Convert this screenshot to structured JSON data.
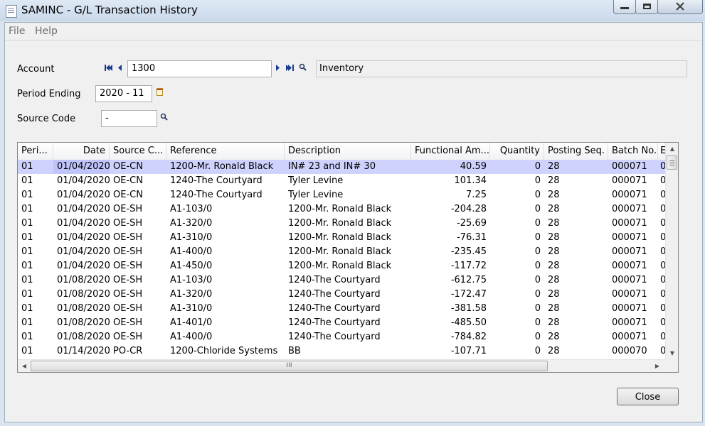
{
  "window": {
    "title": "SAMINC - G/L Transaction History"
  },
  "menu": {
    "file": "File",
    "help": "Help"
  },
  "form": {
    "account_label": "Account",
    "account_value": "1300",
    "account_description": "Inventory",
    "period_label": "Period Ending",
    "period_value": "2020 - 11",
    "source_label": "Source Code",
    "source_value": "-"
  },
  "grid": {
    "columns": [
      "Peri...",
      "Date",
      "Source C...",
      "Reference",
      "Description",
      "Functional Am...",
      "Quantity",
      "Posting Seq.",
      "Batch No.",
      "E"
    ],
    "rows": [
      [
        "01",
        "01/04/2020",
        "OE-CN",
        "1200-Mr. Ronald Black",
        "IN# 23 and IN# 30",
        "40.59",
        "0",
        "28",
        "000071",
        "0"
      ],
      [
        "01",
        "01/04/2020",
        "OE-CN",
        "1240-The Courtyard",
        "Tyler Levine",
        "101.34",
        "0",
        "28",
        "000071",
        "0"
      ],
      [
        "01",
        "01/04/2020",
        "OE-CN",
        "1240-The Courtyard",
        "Tyler Levine",
        "7.25",
        "0",
        "28",
        "000071",
        "0"
      ],
      [
        "01",
        "01/04/2020",
        "OE-SH",
        "A1-103/0",
        "1200-Mr. Ronald Black",
        "-204.28",
        "0",
        "28",
        "000071",
        "0"
      ],
      [
        "01",
        "01/04/2020",
        "OE-SH",
        "A1-320/0",
        "1200-Mr. Ronald Black",
        "-25.69",
        "0",
        "28",
        "000071",
        "0"
      ],
      [
        "01",
        "01/04/2020",
        "OE-SH",
        "A1-310/0",
        "1200-Mr. Ronald Black",
        "-76.31",
        "0",
        "28",
        "000071",
        "0"
      ],
      [
        "01",
        "01/04/2020",
        "OE-SH",
        "A1-400/0",
        "1200-Mr. Ronald Black",
        "-235.45",
        "0",
        "28",
        "000071",
        "0"
      ],
      [
        "01",
        "01/04/2020",
        "OE-SH",
        "A1-450/0",
        "1200-Mr. Ronald Black",
        "-117.72",
        "0",
        "28",
        "000071",
        "0"
      ],
      [
        "01",
        "01/08/2020",
        "OE-SH",
        "A1-103/0",
        "1240-The Courtyard",
        "-612.75",
        "0",
        "28",
        "000071",
        "0"
      ],
      [
        "01",
        "01/08/2020",
        "OE-SH",
        "A1-320/0",
        "1240-The Courtyard",
        "-172.47",
        "0",
        "28",
        "000071",
        "0"
      ],
      [
        "01",
        "01/08/2020",
        "OE-SH",
        "A1-310/0",
        "1240-The Courtyard",
        "-381.58",
        "0",
        "28",
        "000071",
        "0"
      ],
      [
        "01",
        "01/08/2020",
        "OE-SH",
        "A1-401/0",
        "1240-The Courtyard",
        "-485.50",
        "0",
        "28",
        "000071",
        "0"
      ],
      [
        "01",
        "01/08/2020",
        "OE-SH",
        "A1-400/0",
        "1240-The Courtyard",
        "-784.82",
        "0",
        "28",
        "000071",
        "0"
      ],
      [
        "01",
        "01/14/2020",
        "PO-CR",
        "1200-Chloride Systems",
        "BB",
        "-107.71",
        "0",
        "28",
        "000070",
        "0"
      ]
    ],
    "selected_row": 0,
    "hscroll_grip": "III"
  },
  "buttons": {
    "close": "Close",
    "minimize_icon": "minimize-icon",
    "maximize_icon": "maximize-icon",
    "close_window_icon": "close-icon"
  },
  "colors": {
    "selected_row": "#cfd2fd",
    "title_bar": "#c9d8ea"
  }
}
